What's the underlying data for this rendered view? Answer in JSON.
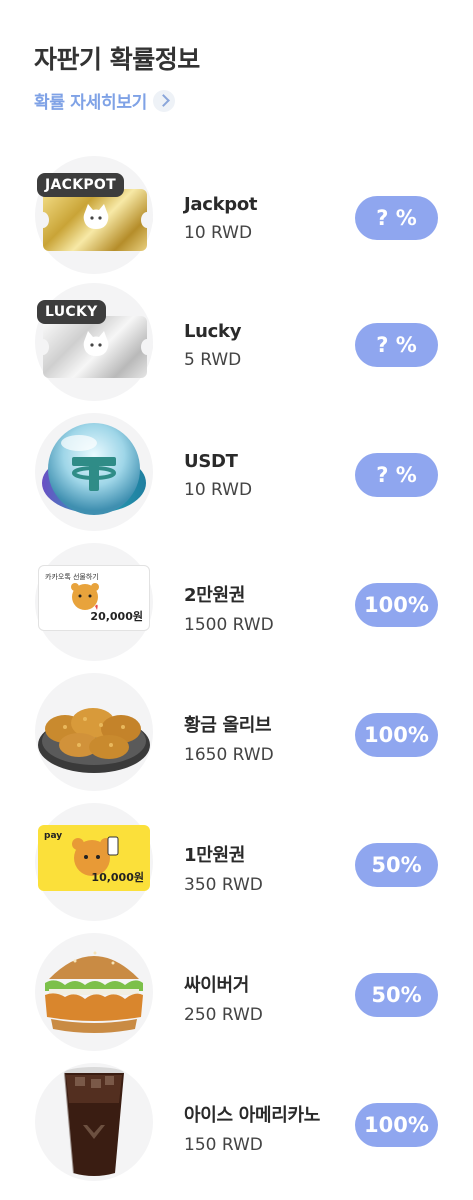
{
  "header": {
    "title": "자판기 확률정보",
    "detail_link": "확률 자세히보기"
  },
  "items": [
    {
      "name": "Jackpot",
      "price": "10 RWD",
      "probability": "? %",
      "icon": "jackpot-ticket-icon",
      "tag": "JACKPOT"
    },
    {
      "name": "Lucky",
      "price": "5 RWD",
      "probability": "? %",
      "icon": "lucky-ticket-icon",
      "tag": "LUCKY"
    },
    {
      "name": "USDT",
      "price": "10 RWD",
      "probability": "? %",
      "icon": "usdt-coin-icon"
    },
    {
      "name": "2만원권",
      "price": "1500 RWD",
      "probability": "100%",
      "icon": "gift-card-20000-icon",
      "card_amount": "20,000원",
      "card_header": "카카오톡 선물하기"
    },
    {
      "name": "황금 올리브",
      "price": "1650 RWD",
      "probability": "100%",
      "icon": "fried-chicken-icon"
    },
    {
      "name": "1만원권",
      "price": "350 RWD",
      "probability": "50%",
      "icon": "kakaopay-card-10000-icon",
      "card_amount": "10,000원",
      "card_header": "pay"
    },
    {
      "name": "싸이버거",
      "price": "250 RWD",
      "probability": "50%",
      "icon": "burger-icon"
    },
    {
      "name": "아이스 아메리카노",
      "price": "150 RWD",
      "probability": "100%",
      "icon": "iced-americano-icon"
    }
  ],
  "colors": {
    "badge": "#8fa6ef",
    "link": "#7fa2e6",
    "thumb_bg": "#f4f4f5"
  }
}
